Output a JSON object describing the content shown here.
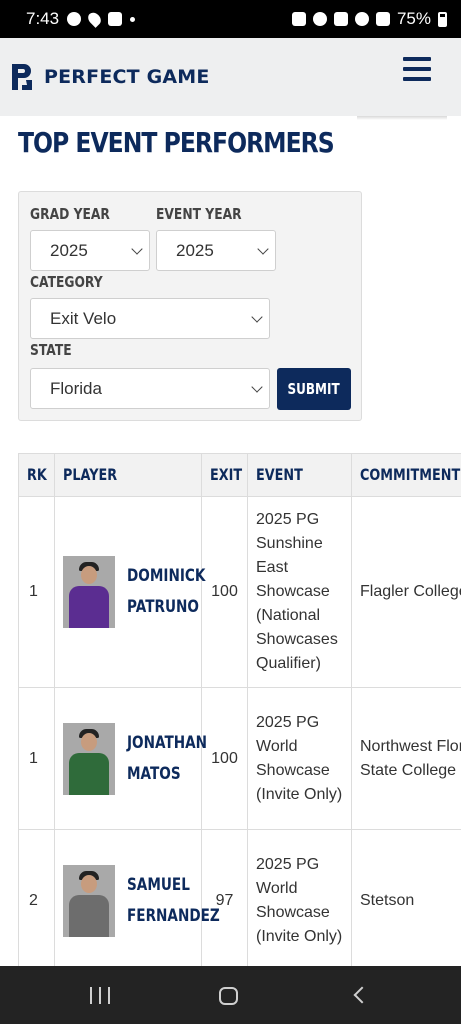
{
  "status_bar": {
    "time": "7:43",
    "battery": "75%"
  },
  "header": {
    "logo_text": "PERFECT GAME"
  },
  "page_title": "TOP EVENT PERFORMERS",
  "filters": {
    "grad_year_label": "GRAD YEAR",
    "grad_year_value": "2025",
    "event_year_label": "EVENT YEAR",
    "event_year_value": "2025",
    "category_label": "CATEGORY",
    "category_value": "Exit Velo",
    "state_label": "STATE",
    "state_value": "Florida",
    "submit_label": "SUBMIT"
  },
  "table": {
    "headers": {
      "rk": "RK",
      "player": "PLAYER",
      "exit": "EXIT",
      "event": "EVENT",
      "commitment": "COMMITMENT"
    },
    "rows": [
      {
        "rk": "1",
        "first": "DOMINICK",
        "last": "PATRUNO",
        "exit": "100",
        "event": "2025 PG Sunshine East Showcase (National Showcases Qualifier)",
        "commitment": "Flagler College",
        "jersey_color": "#5b2d91"
      },
      {
        "rk": "1",
        "first": "JONATHAN",
        "last": "MATOS",
        "exit": "100",
        "event": "2025 PG World Showcase (Invite Only)",
        "commitment": "Northwest Florida State College",
        "jersey_color": "#2f6b3a"
      },
      {
        "rk": "2",
        "first": "SAMUEL",
        "last": "FERNANDEZ",
        "exit": "97",
        "event": "2025 PG World Showcase (Invite Only)",
        "commitment": "Stetson",
        "jersey_color": "#6d6d6d"
      }
    ]
  },
  "colors": {
    "brand_navy": "#0d2a5c"
  }
}
